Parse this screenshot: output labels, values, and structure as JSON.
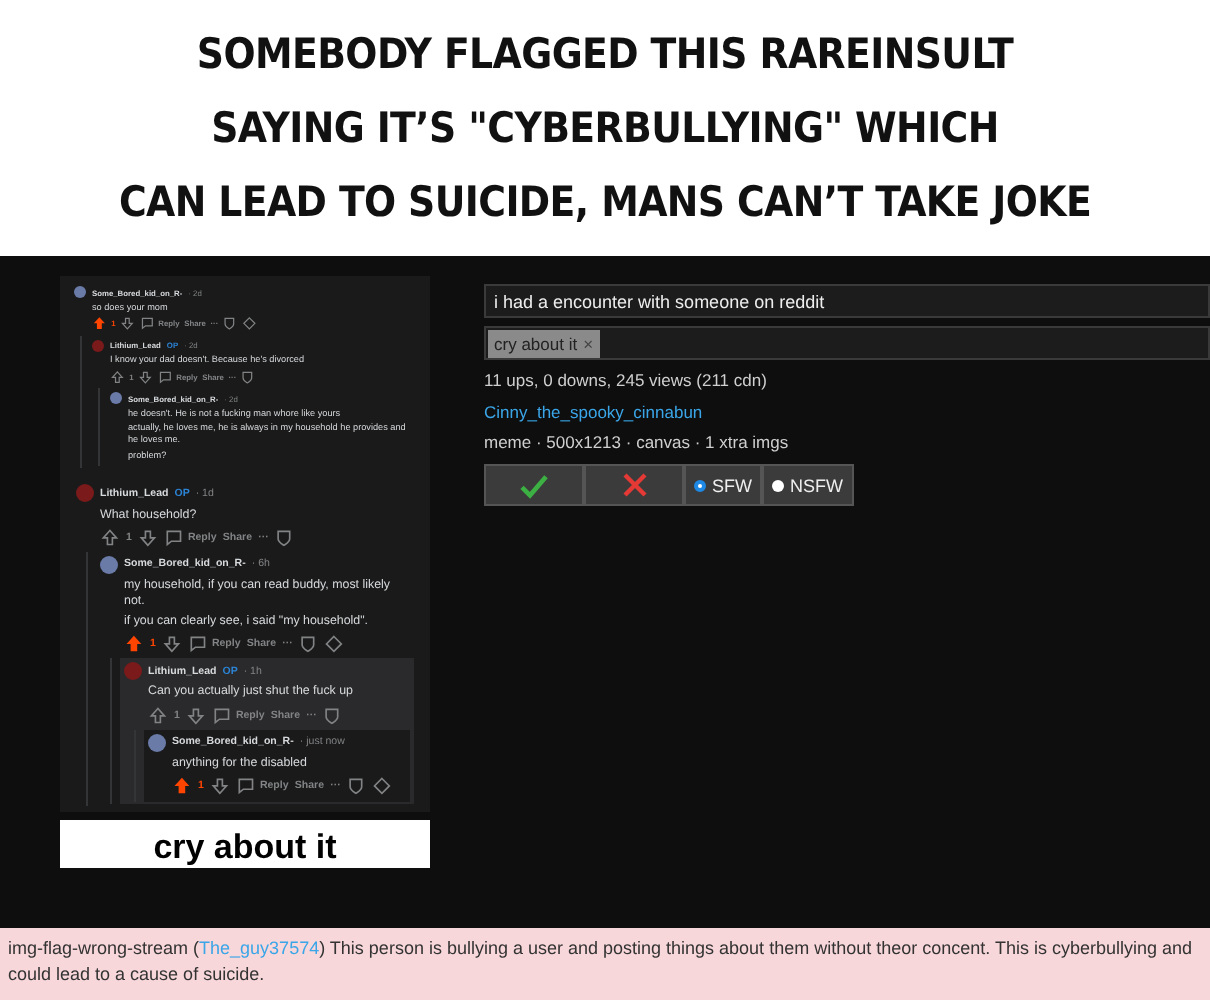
{
  "caption_lines": [
    "SOMEBODY FLAGGED THIS RAREINSULT",
    "SAYING IT’S \"CYBERBULLYING\" WHICH",
    "CAN LEAD TO SUICIDE, MANS CAN’T TAKE JOKE"
  ],
  "screenshots": [
    {
      "kind": "compact",
      "comments": [
        {
          "user": "Some_Bored_kid_on_R-",
          "time": "· 2d",
          "lines": [
            "so does your mom"
          ],
          "votes": "1",
          "upvoted": true,
          "highlighted": false,
          "reply": "Reply",
          "share": "Share",
          "more": "···",
          "children": [
            {
              "user": "Lithium_Lead",
              "op": "OP",
              "time": "· 2d",
              "lines": [
                "I know your dad doesn't. Because he's divorced"
              ],
              "votes": "1",
              "upvoted": false,
              "highlighted": false,
              "reply": "Reply",
              "share": "Share",
              "more": "···",
              "children": [
                {
                  "user": "Some_Bored_kid_on_R-",
                  "time": "· 2d",
                  "lines": [
                    "he doesn't. He is not a fucking man whore like yours",
                    "actually, he loves me, he is always in my household he provides and he loves me.",
                    "problem?"
                  ],
                  "highlighted": false
                }
              ]
            }
          ]
        }
      ]
    },
    {
      "kind": "large",
      "comments": [
        {
          "user": "Lithium_Lead",
          "op": "OP",
          "time": "· 1d",
          "lines": [
            "What household?"
          ],
          "votes": "1",
          "upvoted": false,
          "highlighted": false,
          "reply": "Reply",
          "share": "Share",
          "more": "···",
          "children": [
            {
              "user": "Some_Bored_kid_on_R-",
              "time": "· 6h",
              "lines": [
                "my household, if you can read buddy, most likely not.",
                "if you can clearly see, i said \"my household\"."
              ],
              "votes": "1",
              "upvoted": true,
              "highlighted": false,
              "reply": "Reply",
              "share": "Share",
              "more": "···",
              "children": [
                {
                  "user": "Lithium_Lead",
                  "op": "OP",
                  "time": "· 1h",
                  "lines": [
                    "Can you actually just shut the fuck up"
                  ],
                  "votes": "1",
                  "upvoted": false,
                  "highlighted": true,
                  "reply": "Reply",
                  "share": "Share",
                  "more": "···",
                  "children": [
                    {
                      "user": "Some_Bored_kid_on_R-",
                      "time": "· just now",
                      "lines": [
                        "anything for the disabled"
                      ],
                      "votes": "1",
                      "upvoted": true,
                      "highlighted": false,
                      "reply": "Reply",
                      "share": "Share",
                      "more": "···"
                    }
                  ]
                }
              ]
            }
          ]
        }
      ]
    }
  ],
  "meme_caption": "cry about it",
  "meme_info": {
    "title": "i had a encounter with someone on reddit",
    "tags": [
      {
        "label": "cry about it",
        "remove": "×"
      }
    ],
    "stats": "11 ups, 0 downs, 245 views (211 cdn)",
    "author": "Cinny_the_spooky_cinnabun",
    "meta": "meme · 500x1213 · canvas · 1 xtra imgs",
    "ratings": [
      {
        "label": "SFW",
        "selected": true
      },
      {
        "label": "NSFW",
        "selected": false
      }
    ]
  },
  "flag": {
    "before": "img-flag-wrong-stream (",
    "user": "The_guy37574",
    "after": ") This person is bullying a user and posting things about them without theor concent. This is cyberbullying and could lead to a cause of suicide."
  }
}
